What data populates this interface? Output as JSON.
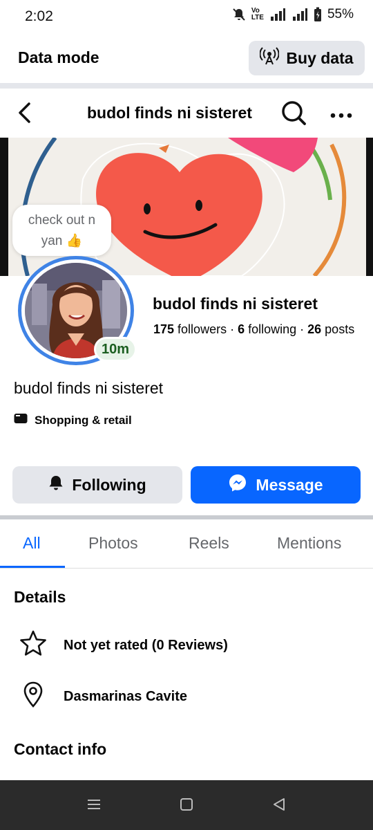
{
  "status": {
    "time": "2:02",
    "battery": "55%",
    "network": "4G"
  },
  "data_bar": {
    "title": "Data mode",
    "buy_label": "Buy data"
  },
  "header": {
    "title": "budol finds ni sisteret"
  },
  "note": {
    "line1": "check out n",
    "line2": "yan 👍"
  },
  "profile": {
    "name": "budol finds ni sisteret",
    "followers_count": "175",
    "followers_label": " followers · ",
    "following_count": "6",
    "following_label": " following · ",
    "posts_count": "26",
    "posts_label": " posts",
    "active_time": "10m",
    "bio": "budol finds ni sisteret",
    "category": "Shopping & retail"
  },
  "actions": {
    "following_label": "Following",
    "message_label": "Message"
  },
  "tabs": [
    {
      "label": "All",
      "active": true
    },
    {
      "label": "Photos",
      "active": false
    },
    {
      "label": "Reels",
      "active": false
    },
    {
      "label": "Mentions",
      "active": false
    }
  ],
  "details": {
    "title": "Details",
    "rating": "Not yet rated (0 Reviews)",
    "location": "Dasmarinas Cavite"
  },
  "contact": {
    "title": "Contact info"
  },
  "colors": {
    "accent": "#0866ff",
    "badge_green": "#e7f3e8",
    "ring": "#3f83e6"
  },
  "icons": [
    "bell-mute-icon",
    "signal-icon",
    "battery-icon",
    "broadcast-icon",
    "back-arrow-icon",
    "search-icon",
    "more-icon",
    "store-icon",
    "bell-icon",
    "messenger-icon",
    "star-icon",
    "location-pin-icon"
  ]
}
